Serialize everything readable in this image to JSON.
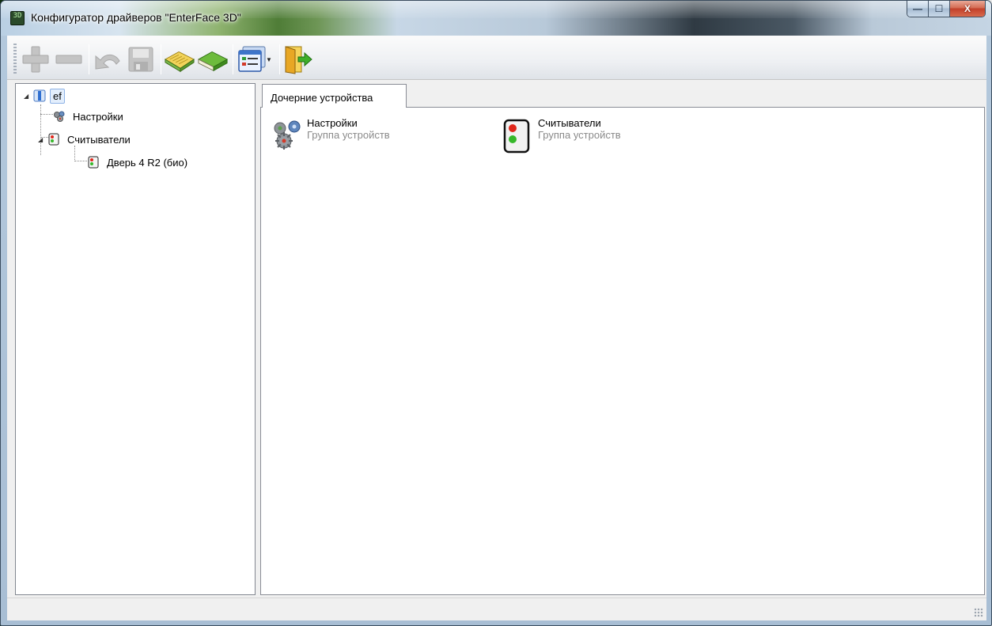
{
  "window": {
    "title": "Конфигуратор драйверов \"EnterFace 3D\"",
    "app_icon_text": "3D",
    "controls": {
      "minimize": "—",
      "maximize": "☐",
      "close": "X"
    }
  },
  "toolbar": {
    "buttons": [
      {
        "name": "add",
        "icon": "plus-icon",
        "enabled": false
      },
      {
        "name": "remove",
        "icon": "minus-icon",
        "enabled": false
      },
      {
        "name": "undo",
        "icon": "undo-arrow-icon",
        "enabled": false
      },
      {
        "name": "save",
        "icon": "floppy-disk-icon",
        "enabled": false
      },
      {
        "name": "open-book",
        "icon": "open-book-icon",
        "enabled": true
      },
      {
        "name": "closed-book",
        "icon": "closed-book-icon",
        "enabled": true
      },
      {
        "name": "view-mode",
        "icon": "list-view-icon",
        "enabled": true,
        "dropdown": true
      },
      {
        "name": "exit",
        "icon": "exit-door-icon",
        "enabled": true
      }
    ]
  },
  "tree": {
    "nodes": [
      {
        "label": "ef",
        "icon": "driver-icon",
        "expanded": true,
        "selected": true,
        "level": 0
      },
      {
        "label": "Настройки",
        "icon": "gears-icon",
        "level": 1
      },
      {
        "label": "Считыватели",
        "icon": "traffic-light-icon",
        "expanded": true,
        "level": 1
      },
      {
        "label": "Дверь 4 R2 (био)",
        "icon": "traffic-light-icon",
        "level": 2
      }
    ]
  },
  "tabs": [
    {
      "label": "Дочерние устройства",
      "active": true
    }
  ],
  "child_devices": [
    {
      "title": "Настройки",
      "subtitle": "Группа устройств",
      "icon": "gears-icon"
    },
    {
      "title": "Считыватели",
      "subtitle": "Группа устройств",
      "icon": "traffic-light-icon"
    }
  ],
  "colors": {
    "selection_bg": "#e3eefc",
    "selection_border": "#8fb3e6",
    "subtitle_gray": "#8a8a8a",
    "close_red": "#c2402a"
  }
}
